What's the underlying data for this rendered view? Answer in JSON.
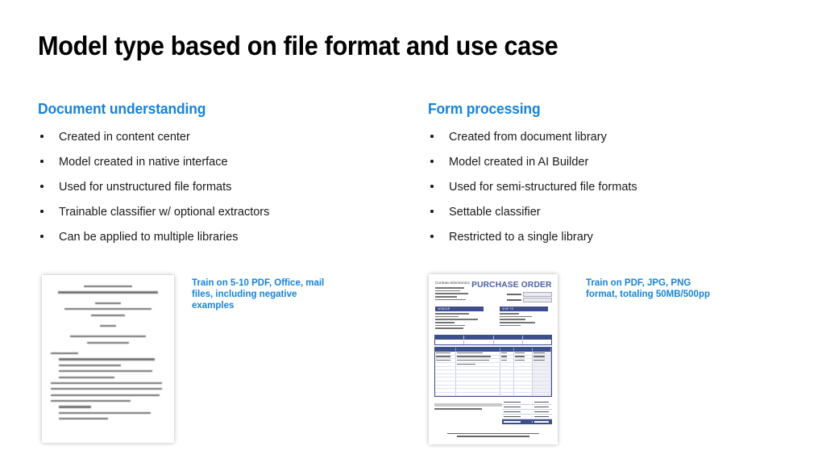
{
  "slide": {
    "title": "Model type based on file format and use case"
  },
  "columns": [
    {
      "heading": "Document understanding",
      "bullets": [
        "Created in content center",
        "Model created in native interface",
        "Used for unstructured file formats",
        "Trainable classifier w/ optional extractors",
        "Can be applied to multiple libraries"
      ],
      "caption": "Train on 5-10 PDF, Office, mail files, including negative examples",
      "thumbnail": {
        "kind": "text-document-thumbnail",
        "alt": "Scanned services agreement document"
      }
    },
    {
      "heading": "Form processing",
      "bullets": [
        "Created from document library",
        "Model created in AI Builder",
        "Used for semi-structured file formats",
        "Settable classifier",
        "Restricted to a single library"
      ],
      "caption": "Train on PDF, JPG, PNG format, totaling 50MB/500pp",
      "thumbnail": {
        "kind": "purchase-order-thumbnail",
        "alt": "Purchase order form",
        "doc_title": "PURCHASE ORDER",
        "company": "Contoso Electronics",
        "label_bars": [
          "VENDOR",
          "SHIP TO"
        ]
      }
    }
  ],
  "colors": {
    "accent_blue": "#1683d8",
    "po_navy": "#3d4e8c",
    "po_title_blue": "#4a5fa5",
    "body_text": "#1a1a1a",
    "background": "#ffffff"
  }
}
